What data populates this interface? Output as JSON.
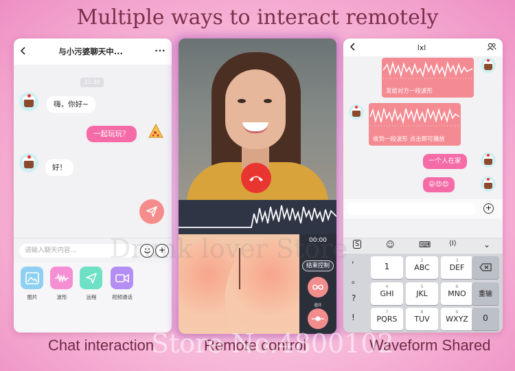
{
  "headline": "Multiple ways to interact remotely",
  "captions": {
    "chat": "Chat interaction",
    "remote": "Remote control",
    "waveform": "Waveform Shared"
  },
  "watermarks": {
    "a": "Drunk lover Store",
    "b": "Store No.4800102"
  },
  "chat_phone": {
    "back_icon": "chevron-left-icon",
    "title": "与小污婆聊天中...",
    "more": "•••",
    "time": "21:30",
    "messages": [
      {
        "side": "left",
        "text": "嗨，你好~"
      },
      {
        "side": "right",
        "text": "一起玩玩？"
      },
      {
        "side": "left",
        "text": "好！"
      }
    ],
    "input_placeholder": "请输入聊天内容...",
    "emoji_icon": "emoji-icon",
    "plus_label": "+",
    "tools": [
      {
        "label": "图片",
        "color": "#8fd0f2",
        "icon": "image-icon"
      },
      {
        "label": "波形",
        "color": "#f48fd3",
        "icon": "waveform-icon"
      },
      {
        "label": "远程",
        "color": "#6ee0c5",
        "icon": "send-icon"
      },
      {
        "label": "视频通话",
        "color": "#b48ef2",
        "icon": "video-icon"
      }
    ]
  },
  "remote_phone": {
    "timer": "00:00",
    "end_label": "结束控制",
    "loop_label": "循环",
    "hangup_icon": "phone-hangup-icon"
  },
  "wave_phone": {
    "title": "lxl",
    "user_icon": "users-icon",
    "cards": [
      {
        "text": "发给对方一段波形"
      },
      {
        "text": "收到一段波形   点击即可播放"
      }
    ],
    "messages": [
      "一个人在家",
      "😜😍😍"
    ],
    "toolbar": [
      "S",
      "☺",
      "⌨",
      "⟨I⟩",
      "⌄"
    ],
    "symbols": [
      ",",
      "。",
      "?",
      "!"
    ],
    "keys": [
      {
        "n": "",
        "l": "1"
      },
      {
        "n": "2",
        "l": "ABC"
      },
      {
        "n": "3",
        "l": "DEF"
      },
      {
        "n": "4",
        "l": "GHI"
      },
      {
        "n": "5",
        "l": "JKL"
      },
      {
        "n": "6",
        "l": "MNO"
      },
      {
        "n": "7",
        "l": "PQRS"
      },
      {
        "n": "8",
        "l": "TUV"
      },
      {
        "n": "9",
        "l": "WXYZ"
      }
    ],
    "backspace_icon": "backspace-icon",
    "retype_label": "重输",
    "zero_label": "0"
  }
}
